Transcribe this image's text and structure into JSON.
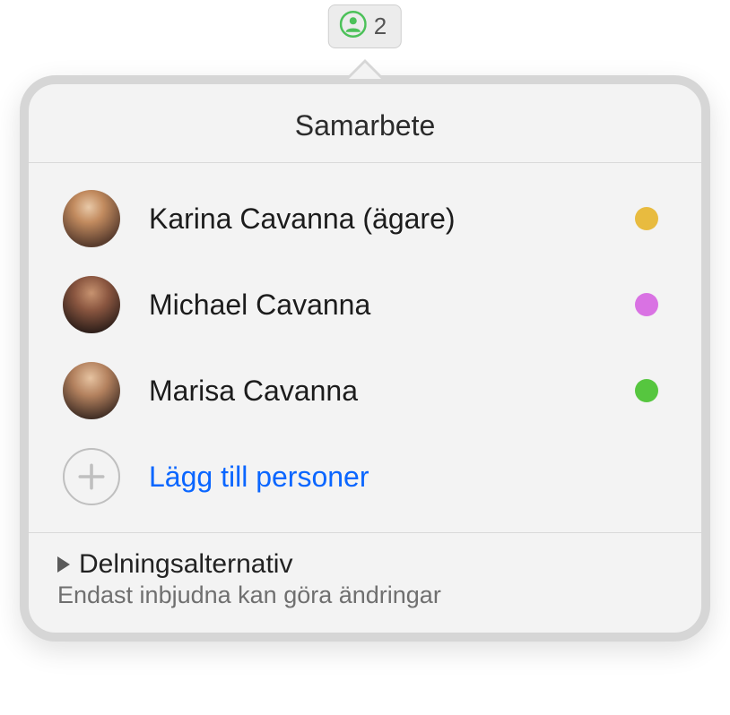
{
  "toolbar": {
    "count": "2",
    "icon_color": "#4cc159"
  },
  "popover": {
    "title": "Samarbete",
    "participants": [
      {
        "name": "Karina Cavanna (ägare)",
        "color": "#e8bb3f",
        "avatar": "avatar-1"
      },
      {
        "name": "Michael Cavanna",
        "color": "#d972e3",
        "avatar": "avatar-2"
      },
      {
        "name": "Marisa Cavanna",
        "color": "#56c63f",
        "avatar": "avatar-3"
      }
    ],
    "add_label": "Lägg till personer",
    "options": {
      "title": "Delningsalternativ",
      "subtitle": "Endast inbjudna kan göra ändringar"
    }
  }
}
